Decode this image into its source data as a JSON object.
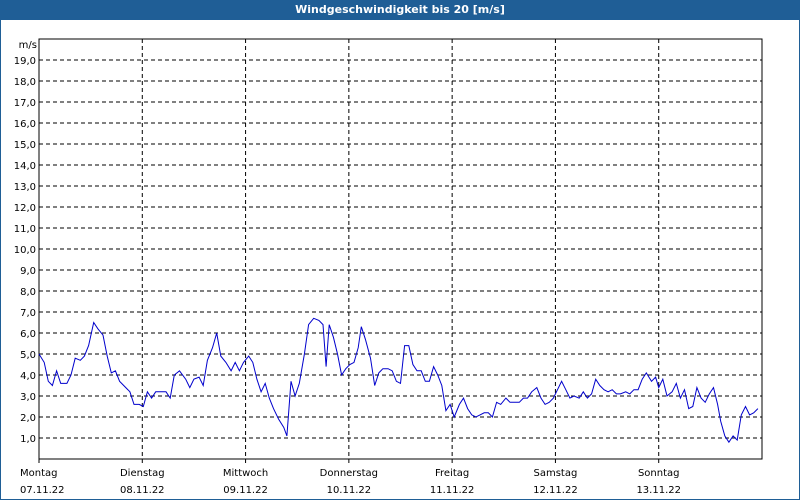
{
  "header": {
    "title": "Windgeschwindigkeit bis 20 [m/s]"
  },
  "chart_data": {
    "type": "line",
    "title": "Windgeschwindigkeit bis 20 [m/s]",
    "ylabel": "m/s",
    "ylim": [
      0,
      20
    ],
    "grid": true,
    "y_ticks": [
      "1,0",
      "2,0",
      "3,0",
      "4,0",
      "5,0",
      "6,0",
      "7,0",
      "8,0",
      "9,0",
      "10,0",
      "11,0",
      "12,0",
      "13,0",
      "14,0",
      "15,0",
      "16,0",
      "17,0",
      "18,0",
      "19,0"
    ],
    "x_range_days": [
      0,
      7
    ],
    "x_ticks": [
      {
        "day": "Montag",
        "date": "07.11.22"
      },
      {
        "day": "Dienstag",
        "date": "08.11.22"
      },
      {
        "day": "Mittwoch",
        "date": "09.11.22"
      },
      {
        "day": "Donnerstag",
        "date": "10.11.22"
      },
      {
        "day": "Freitag",
        "date": "11.11.22"
      },
      {
        "day": "Samstag",
        "date": "12.11.22"
      },
      {
        "day": "Sonntag",
        "date": "13.11.22"
      }
    ],
    "line_color": "#0000cc",
    "series": [
      {
        "points": [
          [
            0.0,
            5.0
          ],
          [
            0.05,
            4.6
          ],
          [
            0.09,
            3.7
          ],
          [
            0.13,
            3.5
          ],
          [
            0.17,
            4.2
          ],
          [
            0.21,
            3.6
          ],
          [
            0.27,
            3.6
          ],
          [
            0.31,
            4.0
          ],
          [
            0.35,
            4.8
          ],
          [
            0.4,
            4.7
          ],
          [
            0.44,
            4.9
          ],
          [
            0.48,
            5.4
          ],
          [
            0.53,
            6.5
          ],
          [
            0.57,
            6.2
          ],
          [
            0.62,
            5.9
          ],
          [
            0.66,
            4.9
          ],
          [
            0.7,
            4.1
          ],
          [
            0.74,
            4.2
          ],
          [
            0.78,
            3.7
          ],
          [
            0.84,
            3.4
          ],
          [
            0.88,
            3.2
          ],
          [
            0.92,
            2.6
          ],
          [
            0.97,
            2.6
          ],
          [
            1.01,
            2.5
          ],
          [
            1.05,
            3.2
          ],
          [
            1.09,
            2.9
          ],
          [
            1.13,
            3.2
          ],
          [
            1.18,
            3.2
          ],
          [
            1.23,
            3.2
          ],
          [
            1.27,
            2.9
          ],
          [
            1.31,
            4.0
          ],
          [
            1.36,
            4.2
          ],
          [
            1.42,
            3.8
          ],
          [
            1.46,
            3.4
          ],
          [
            1.5,
            3.8
          ],
          [
            1.55,
            3.9
          ],
          [
            1.59,
            3.5
          ],
          [
            1.63,
            4.7
          ],
          [
            1.68,
            5.3
          ],
          [
            1.72,
            6.0
          ],
          [
            1.76,
            4.9
          ],
          [
            1.81,
            4.6
          ],
          [
            1.86,
            4.2
          ],
          [
            1.9,
            4.6
          ],
          [
            1.94,
            4.2
          ],
          [
            1.98,
            4.6
          ],
          [
            2.03,
            4.9
          ],
          [
            2.07,
            4.6
          ],
          [
            2.11,
            3.8
          ],
          [
            2.15,
            3.2
          ],
          [
            2.19,
            3.6
          ],
          [
            2.23,
            2.9
          ],
          [
            2.27,
            2.4
          ],
          [
            2.32,
            1.9
          ],
          [
            2.37,
            1.5
          ],
          [
            2.4,
            1.1
          ],
          [
            2.44,
            3.7
          ],
          [
            2.48,
            3.0
          ],
          [
            2.52,
            3.6
          ],
          [
            2.57,
            5.0
          ],
          [
            2.61,
            6.4
          ],
          [
            2.66,
            6.7
          ],
          [
            2.71,
            6.6
          ],
          [
            2.75,
            6.4
          ],
          [
            2.78,
            4.4
          ],
          [
            2.81,
            6.4
          ],
          [
            2.85,
            5.8
          ],
          [
            2.89,
            5.0
          ],
          [
            2.93,
            4.0
          ],
          [
            2.97,
            4.3
          ],
          [
            3.01,
            4.5
          ],
          [
            3.05,
            4.6
          ],
          [
            3.09,
            5.3
          ],
          [
            3.12,
            6.3
          ],
          [
            3.16,
            5.7
          ],
          [
            3.21,
            4.8
          ],
          [
            3.25,
            3.5
          ],
          [
            3.29,
            4.1
          ],
          [
            3.33,
            4.3
          ],
          [
            3.38,
            4.3
          ],
          [
            3.42,
            4.2
          ],
          [
            3.46,
            3.7
          ],
          [
            3.5,
            3.6
          ],
          [
            3.54,
            5.4
          ],
          [
            3.58,
            5.4
          ],
          [
            3.62,
            4.5
          ],
          [
            3.66,
            4.2
          ],
          [
            3.7,
            4.2
          ],
          [
            3.74,
            3.7
          ],
          [
            3.78,
            3.7
          ],
          [
            3.82,
            4.4
          ],
          [
            3.86,
            4.0
          ],
          [
            3.9,
            3.5
          ],
          [
            3.94,
            2.3
          ],
          [
            3.98,
            2.6
          ],
          [
            4.02,
            2.0
          ],
          [
            4.07,
            2.6
          ],
          [
            4.11,
            2.9
          ],
          [
            4.15,
            2.4
          ],
          [
            4.19,
            2.1
          ],
          [
            4.23,
            2.0
          ],
          [
            4.27,
            2.1
          ],
          [
            4.31,
            2.2
          ],
          [
            4.35,
            2.2
          ],
          [
            4.39,
            2.0
          ],
          [
            4.43,
            2.7
          ],
          [
            4.47,
            2.6
          ],
          [
            4.52,
            2.9
          ],
          [
            4.56,
            2.7
          ],
          [
            4.6,
            2.7
          ],
          [
            4.65,
            2.7
          ],
          [
            4.69,
            2.9
          ],
          [
            4.73,
            2.9
          ],
          [
            4.77,
            3.2
          ],
          [
            4.82,
            3.4
          ],
          [
            4.86,
            2.9
          ],
          [
            4.9,
            2.6
          ],
          [
            4.94,
            2.7
          ],
          [
            4.98,
            2.9
          ],
          [
            5.02,
            3.3
          ],
          [
            5.06,
            3.7
          ],
          [
            5.1,
            3.3
          ],
          [
            5.14,
            2.9
          ],
          [
            5.18,
            3.0
          ],
          [
            5.23,
            2.9
          ],
          [
            5.27,
            3.2
          ],
          [
            5.31,
            2.9
          ],
          [
            5.35,
            3.1
          ],
          [
            5.39,
            3.8
          ],
          [
            5.43,
            3.5
          ],
          [
            5.47,
            3.3
          ],
          [
            5.51,
            3.2
          ],
          [
            5.55,
            3.3
          ],
          [
            5.59,
            3.1
          ],
          [
            5.63,
            3.1
          ],
          [
            5.68,
            3.2
          ],
          [
            5.72,
            3.1
          ],
          [
            5.76,
            3.3
          ],
          [
            5.8,
            3.3
          ],
          [
            5.84,
            3.8
          ],
          [
            5.88,
            4.1
          ],
          [
            5.93,
            3.7
          ],
          [
            5.97,
            3.9
          ],
          [
            6.0,
            3.4
          ],
          [
            6.04,
            3.8
          ],
          [
            6.08,
            3.0
          ],
          [
            6.13,
            3.2
          ],
          [
            6.17,
            3.6
          ],
          [
            6.21,
            2.9
          ],
          [
            6.25,
            3.3
          ],
          [
            6.29,
            2.4
          ],
          [
            6.33,
            2.5
          ],
          [
            6.37,
            3.4
          ],
          [
            6.41,
            2.9
          ],
          [
            6.45,
            2.7
          ],
          [
            6.49,
            3.1
          ],
          [
            6.53,
            3.4
          ],
          [
            6.57,
            2.6
          ],
          [
            6.6,
            1.8
          ],
          [
            6.64,
            1.1
          ],
          [
            6.68,
            0.8
          ],
          [
            6.72,
            1.1
          ],
          [
            6.76,
            0.9
          ],
          [
            6.8,
            2.1
          ],
          [
            6.84,
            2.5
          ],
          [
            6.88,
            2.1
          ],
          [
            6.92,
            2.2
          ],
          [
            6.96,
            2.4
          ]
        ]
      }
    ]
  }
}
